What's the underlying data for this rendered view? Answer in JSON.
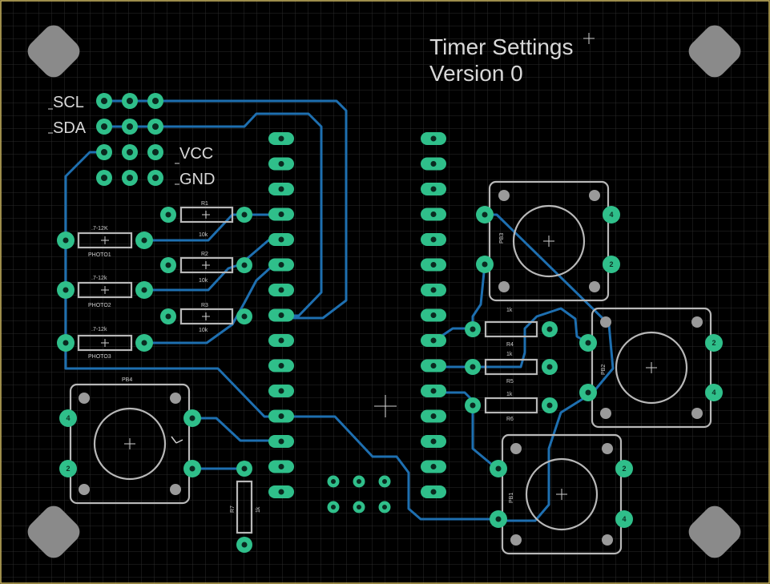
{
  "title": {
    "line1": "Timer Settings",
    "line2": "Version 0"
  },
  "header_labels": {
    "scl": "SCL",
    "sda": "SDA",
    "vcc": "VCC",
    "gnd": "GND"
  },
  "resistors": [
    {
      "ref": "R1",
      "value": "10k"
    },
    {
      "ref": "R2",
      "value": "10k"
    },
    {
      "ref": "R3",
      "value": "10k"
    },
    {
      "ref": "R4",
      "value": "1k"
    },
    {
      "ref": "R5",
      "value": "1k"
    },
    {
      "ref": "R6",
      "value": "1k"
    },
    {
      "ref": "R7",
      "value": "1k"
    }
  ],
  "photoresistors": [
    {
      "ref": "PHOTO1",
      "value": ".7-12K"
    },
    {
      "ref": "PHOTO2",
      "value": ".7-12k"
    },
    {
      "ref": "PHOTO3",
      "value": ".7-12k"
    }
  ],
  "buttons": [
    {
      "ref": "PB1"
    },
    {
      "ref": "PB2"
    },
    {
      "ref": "PB3"
    },
    {
      "ref": "PB4"
    }
  ],
  "pad_numbers": {
    "four": "4",
    "two": "2"
  },
  "colors": {
    "background": "#000000",
    "pad": "#2fbf8a",
    "trace": "#1e6fb0",
    "silk": "#cfcfcf",
    "mount": "#8a8a8a",
    "grid": "#2a2a2a",
    "border": "#c8b25a"
  }
}
